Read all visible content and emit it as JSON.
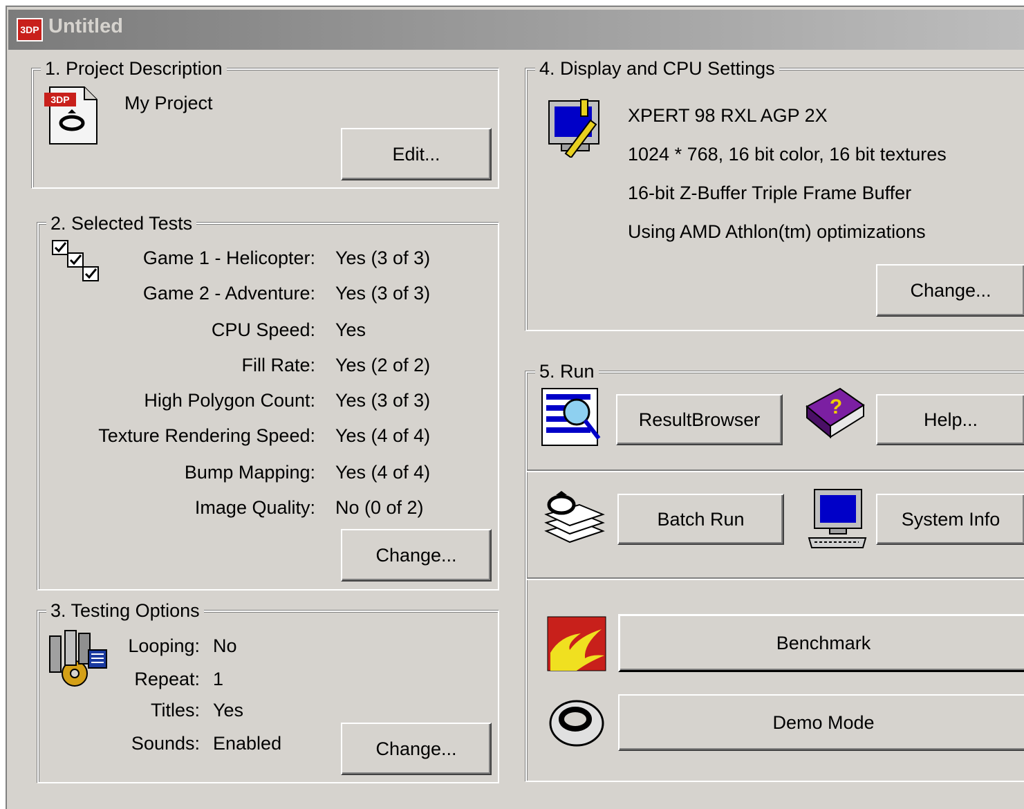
{
  "window": {
    "title": "Untitled",
    "icon": "3dp-app-icon"
  },
  "project": {
    "legend": "1. Project Description",
    "name": "My Project",
    "edit_button": "Edit...",
    "icon_label": "3DP"
  },
  "tests": {
    "legend": "2. Selected Tests",
    "items": [
      {
        "label": "Game 1 - Helicopter:",
        "value": "Yes (3 of 3)"
      },
      {
        "label": "Game 2 - Adventure:",
        "value": "Yes (3 of 3)"
      },
      {
        "label": "CPU Speed:",
        "value": "Yes"
      },
      {
        "label": "Fill Rate:",
        "value": "Yes (2 of 2)"
      },
      {
        "label": "High Polygon Count:",
        "value": "Yes (3 of 3)"
      },
      {
        "label": "Texture Rendering Speed:",
        "value": "Yes (4 of 4)"
      },
      {
        "label": "Bump Mapping:",
        "value": "Yes (4 of 4)"
      },
      {
        "label": "Image Quality:",
        "value": "No (0 of 2)"
      }
    ],
    "change_button": "Change..."
  },
  "options": {
    "legend": "3. Testing Options",
    "items": [
      {
        "label": "Looping:",
        "value": "No"
      },
      {
        "label": "Repeat:",
        "value": "1"
      },
      {
        "label": "Titles:",
        "value": "Yes"
      },
      {
        "label": "Sounds:",
        "value": "Enabled"
      }
    ],
    "change_button": "Change..."
  },
  "display": {
    "legend": "4. Display and CPU Settings",
    "lines": [
      "XPERT 98 RXL AGP 2X",
      "1024 * 768, 16 bit color, 16 bit textures",
      "16-bit Z-Buffer  Triple Frame Buffer",
      "Using  AMD Athlon(tm) optimizations"
    ],
    "change_button": "Change..."
  },
  "run": {
    "legend": "5. Run",
    "result_browser_button": "ResultBrowser",
    "help_button": "Help...",
    "batch_run_button": "Batch Run",
    "system_info_button": "System Info",
    "benchmark_button": "Benchmark",
    "demo_mode_button": "Demo Mode"
  },
  "colors": {
    "face": "#d6d3ce",
    "shadow": "#808080",
    "highlight": "#ffffff",
    "icon_red": "#c8201b",
    "icon_blue": "#0000c8",
    "icon_purple": "#7b1fa2"
  }
}
